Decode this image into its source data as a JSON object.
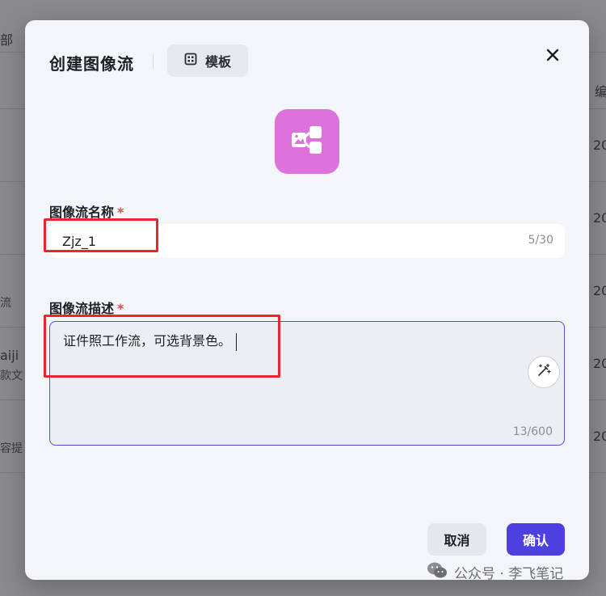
{
  "background": {
    "header_fragment": "部",
    "right_header_fragment": "编",
    "row_fragments": [
      "20",
      "20",
      "20",
      "20",
      "20"
    ],
    "left_text_1": "流",
    "left_text_2": "aiji",
    "left_text_3": "款文",
    "left_text_4": "容提"
  },
  "modal": {
    "title": "创建图像流",
    "template_label": "模板",
    "name_field": {
      "label": "图像流名称",
      "required_mark": "*",
      "value": "Zjz_1",
      "counter": "5/30"
    },
    "desc_field": {
      "label": "图像流描述",
      "required_mark": "*",
      "value": "证件照工作流，可选背景色。",
      "counter": "13/600"
    },
    "cancel_label": "取消",
    "confirm_label": "确认"
  },
  "watermark": {
    "text": "公众号 · 李飞笔记"
  },
  "colors": {
    "accent": "#4e3fe0",
    "app_icon_bg": "#dd72dc",
    "required": "#e5484d",
    "annotation_red": "#e8262b"
  },
  "icons": {
    "template": "grid-icon",
    "close": "close-icon",
    "app": "image-flow-icon",
    "magic": "magic-wand-icon",
    "watermark": "wechat-icon"
  }
}
